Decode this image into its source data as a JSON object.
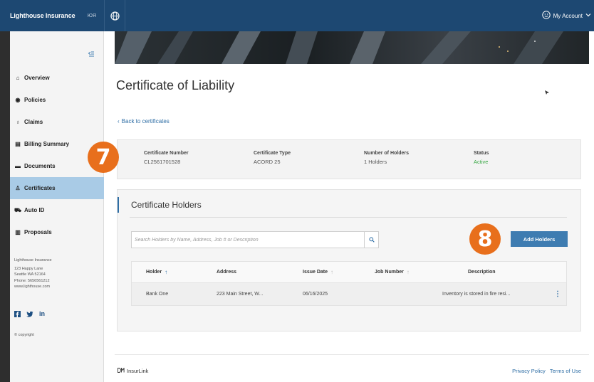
{
  "topbar": {
    "brand": "Lighthouse Insurance",
    "code": "ЮЯ",
    "account_label": "My Account"
  },
  "sidebar": {
    "items": [
      {
        "label": "Overview",
        "icon": "home-icon",
        "glyph": "⌂"
      },
      {
        "label": "Policies",
        "icon": "shield-icon",
        "glyph": "◉"
      },
      {
        "label": "Claims",
        "icon": "claims-icon",
        "glyph": "♁"
      },
      {
        "label": "Billing Summary",
        "icon": "billing-icon",
        "glyph": "▤"
      },
      {
        "label": "Documents",
        "icon": "folder-icon",
        "glyph": "▬"
      },
      {
        "label": "Certificates",
        "icon": "certificate-icon",
        "glyph": "♙"
      },
      {
        "label": "Auto ID",
        "icon": "car-icon",
        "glyph": "⛟"
      },
      {
        "label": "Proposals",
        "icon": "proposals-icon",
        "glyph": "▥"
      }
    ],
    "active_index": 5,
    "company": {
      "name": "Lighthouse Insurance",
      "address1": "123 Happy Lane",
      "address2": "Seattle WA 52164",
      "phone": "Phone: 5656561212",
      "website": "www.lighthouse.com"
    },
    "copyright": "© copyright"
  },
  "main": {
    "title": "Certificate of Liability",
    "back_link": "Back to certificates",
    "summary": {
      "certificate_number": {
        "label": "Certificate Number",
        "value": "CL2561701528"
      },
      "certificate_type": {
        "label": "Certificate Type",
        "value": "ACORD 25"
      },
      "number_of_holders": {
        "label": "Number of Holders",
        "value": "1 Holders"
      },
      "status": {
        "label": "Status",
        "value": "Active"
      }
    },
    "holders": {
      "title": "Certificate Holders",
      "search_placeholder": "Search Holders by Name, Address, Job # or Description",
      "add_button": "Add Holders",
      "columns": [
        "Holder",
        "Address",
        "Issue Date",
        "Job Number",
        "Description"
      ],
      "rows": [
        {
          "holder": "Bank One",
          "address": "223 Main Street, W...",
          "issue_date": "06/16/2025",
          "job_number": "",
          "description": "Inventory is stored in fire resi..."
        }
      ]
    }
  },
  "footer": {
    "logo": "InsurLink",
    "privacy": "Privacy Policy",
    "terms": "Terms of Use"
  },
  "markers": {
    "seven": "7",
    "eight": "8"
  },
  "colors": {
    "topbar": "#1d4872",
    "accent": "#3e7cb1",
    "active_nav": "#a9cbe6",
    "status_active": "#39a845",
    "marker": "#e86f1c"
  }
}
